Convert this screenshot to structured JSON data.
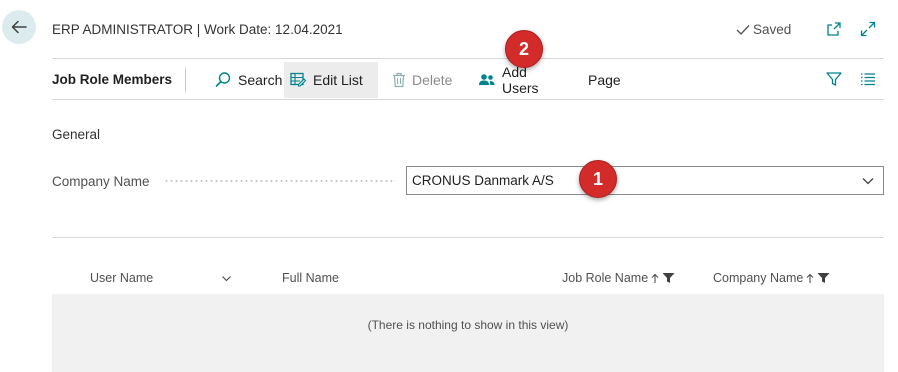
{
  "header": {
    "title": "ERP ADMINISTRATOR | Work Date: 12.04.2021",
    "saved_label": "Saved"
  },
  "actionbar": {
    "caption": "Job Role Members",
    "search_label": "Search",
    "edit_list_label": "Edit List",
    "delete_label": "Delete",
    "add_users_label": "Add Users",
    "page_label": "Page"
  },
  "general": {
    "section_title": "General",
    "company_name_label": "Company Name",
    "company_name_value": "CRONUS Danmark A/S"
  },
  "grid": {
    "columns": [
      "User Name",
      "Full Name",
      "Job Role Name",
      "Company Name"
    ],
    "empty_message": "(There is nothing to show in this view)"
  },
  "annotations": {
    "step1": "1",
    "step2": "2"
  },
  "colors": {
    "accent": "#00838f",
    "badge": "#d32a2a",
    "back_button_bg": "#dcecee"
  }
}
